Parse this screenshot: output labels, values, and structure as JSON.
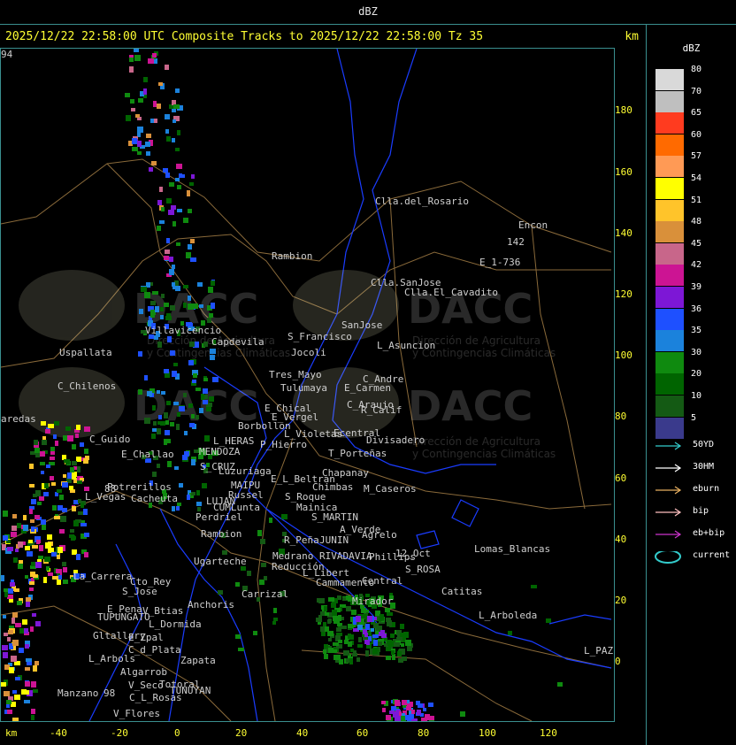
{
  "top_bar": {
    "title": "dBZ"
  },
  "header": {
    "text": "2025/12/22 22:58:00 UTC Composite Tracks to 2025/12/22 22:58:00 Tz 35",
    "km_label": "km"
  },
  "axes": {
    "x_label": "km",
    "x_ticks": [
      "-40",
      "-20",
      "0",
      "20",
      "40",
      "60",
      "80",
      "100",
      "120"
    ],
    "y_ticks": [
      "180",
      "160",
      "140",
      "120",
      "100",
      "80",
      "60",
      "40",
      "20",
      "0"
    ]
  },
  "colors": {
    "frame": "#3a8f8f",
    "header_text": "#ffff33",
    "boundary_blue": "#1a3cff",
    "boundary_tan": "#8a6a3a"
  },
  "legend": {
    "title": "dBZ",
    "scale": [
      {
        "value": "80",
        "color": "#d9d9d9"
      },
      {
        "value": "70",
        "color": "#bfbfbf"
      },
      {
        "value": "65",
        "color": "#ff3b1f"
      },
      {
        "value": "60",
        "color": "#ff6a00"
      },
      {
        "value": "57",
        "color": "#ff9a55"
      },
      {
        "value": "54",
        "color": "#ffff00"
      },
      {
        "value": "51",
        "color": "#ffc42a"
      },
      {
        "value": "48",
        "color": "#d9903a"
      },
      {
        "value": "45",
        "color": "#c8668a"
      },
      {
        "value": "42",
        "color": "#cc1493"
      },
      {
        "value": "39",
        "color": "#7d17d6"
      },
      {
        "value": "36",
        "color": "#1e50ff"
      },
      {
        "value": "35",
        "color": "#1b82dc"
      },
      {
        "value": "30",
        "color": "#0f8a0f"
      },
      {
        "value": "20",
        "color": "#006400"
      },
      {
        "value": "10",
        "color": "#145a14"
      },
      {
        "value": "5",
        "color": "#3a3a8c"
      }
    ],
    "tracks": [
      {
        "label": "50YD",
        "color": "#33cccc",
        "icon": "arrow-icon"
      },
      {
        "label": "30HM",
        "color": "#ffffff",
        "icon": "arrow-icon"
      },
      {
        "label": "eburn",
        "color": "#e8b060",
        "icon": "arrow-icon"
      },
      {
        "label": "bip",
        "color": "#ffc0c0",
        "icon": "arrow-icon"
      },
      {
        "label": "eb+bip",
        "color": "#cc33cc",
        "icon": "arrow-icon"
      },
      {
        "label": "current",
        "color": "#33cccc",
        "icon": "ellipse-icon"
      }
    ]
  },
  "watermark": {
    "brand": "DACC",
    "line1": "Dirección de Agricultura",
    "line2": "y Contingencias Climáticas"
  },
  "places": [
    "Clla.del_Rosario",
    "Encon",
    "142",
    "E_1-736",
    "Rambion",
    "Clla.SanJose",
    "Clla.El_Cavadito",
    "Villavicencio",
    "Uspallata",
    "Capdevila",
    "S_Francisco",
    "SanJose",
    "L_Asuncion",
    "Jocoli",
    "Tres_Mayo",
    "C_Andre",
    "Tulumaya",
    "E_Carmen",
    "C_Chilenos",
    "E_Chical",
    "C_Araujo",
    "R_Calif",
    "E_Vergel",
    "Borbollon",
    "Ecentral",
    "Divisadero",
    "L_Violetas",
    "C_Guido",
    "L_HERAS",
    "P_Hierro",
    "E_Challao",
    "MENDOZA",
    "T_Porteñas",
    "S_CRUZ",
    "Luzuriaga",
    "Chapanay",
    "MAIPU",
    "E_L_Beltran",
    "Potrerillos",
    "Russel",
    "Chimbas",
    "M_Caseros",
    "L_Vegas",
    "Cacheuta",
    "LUJAN",
    "S_Roque",
    "Mainica",
    "CUMLunta",
    "Perdriel",
    "S_MARTIN",
    "A_Verde",
    "Agrelo",
    "Rambion",
    "R_Peña",
    "JUNIN",
    "Lomas_Blancas",
    "Ugarteche",
    "Medrano",
    "RIVADAVIA",
    "Phillips",
    "12_Oct",
    "Reducción",
    "L_Libert",
    "S_ROSA",
    "La_Carrera",
    "Cto_Rey",
    "Carrizal",
    "Cammamento",
    "Central",
    "Catitas",
    "S_Jose",
    "Anchoris",
    "Mirador",
    "E_Pena",
    "V_Btias",
    "TUPUNGATO",
    "L_Dormida",
    "L_Arboleda",
    "Gltallary",
    "E_Zpal",
    "C_d_Plata",
    "L_PAZ",
    "L_Arbols",
    "Zapata",
    "Algarrob",
    "V_Seco",
    "Totoral",
    "TUNUYAN",
    "Manzano",
    "C_L_Rosas",
    "V_Flores",
    "aredas",
    "88",
    "98",
    "94"
  ]
}
